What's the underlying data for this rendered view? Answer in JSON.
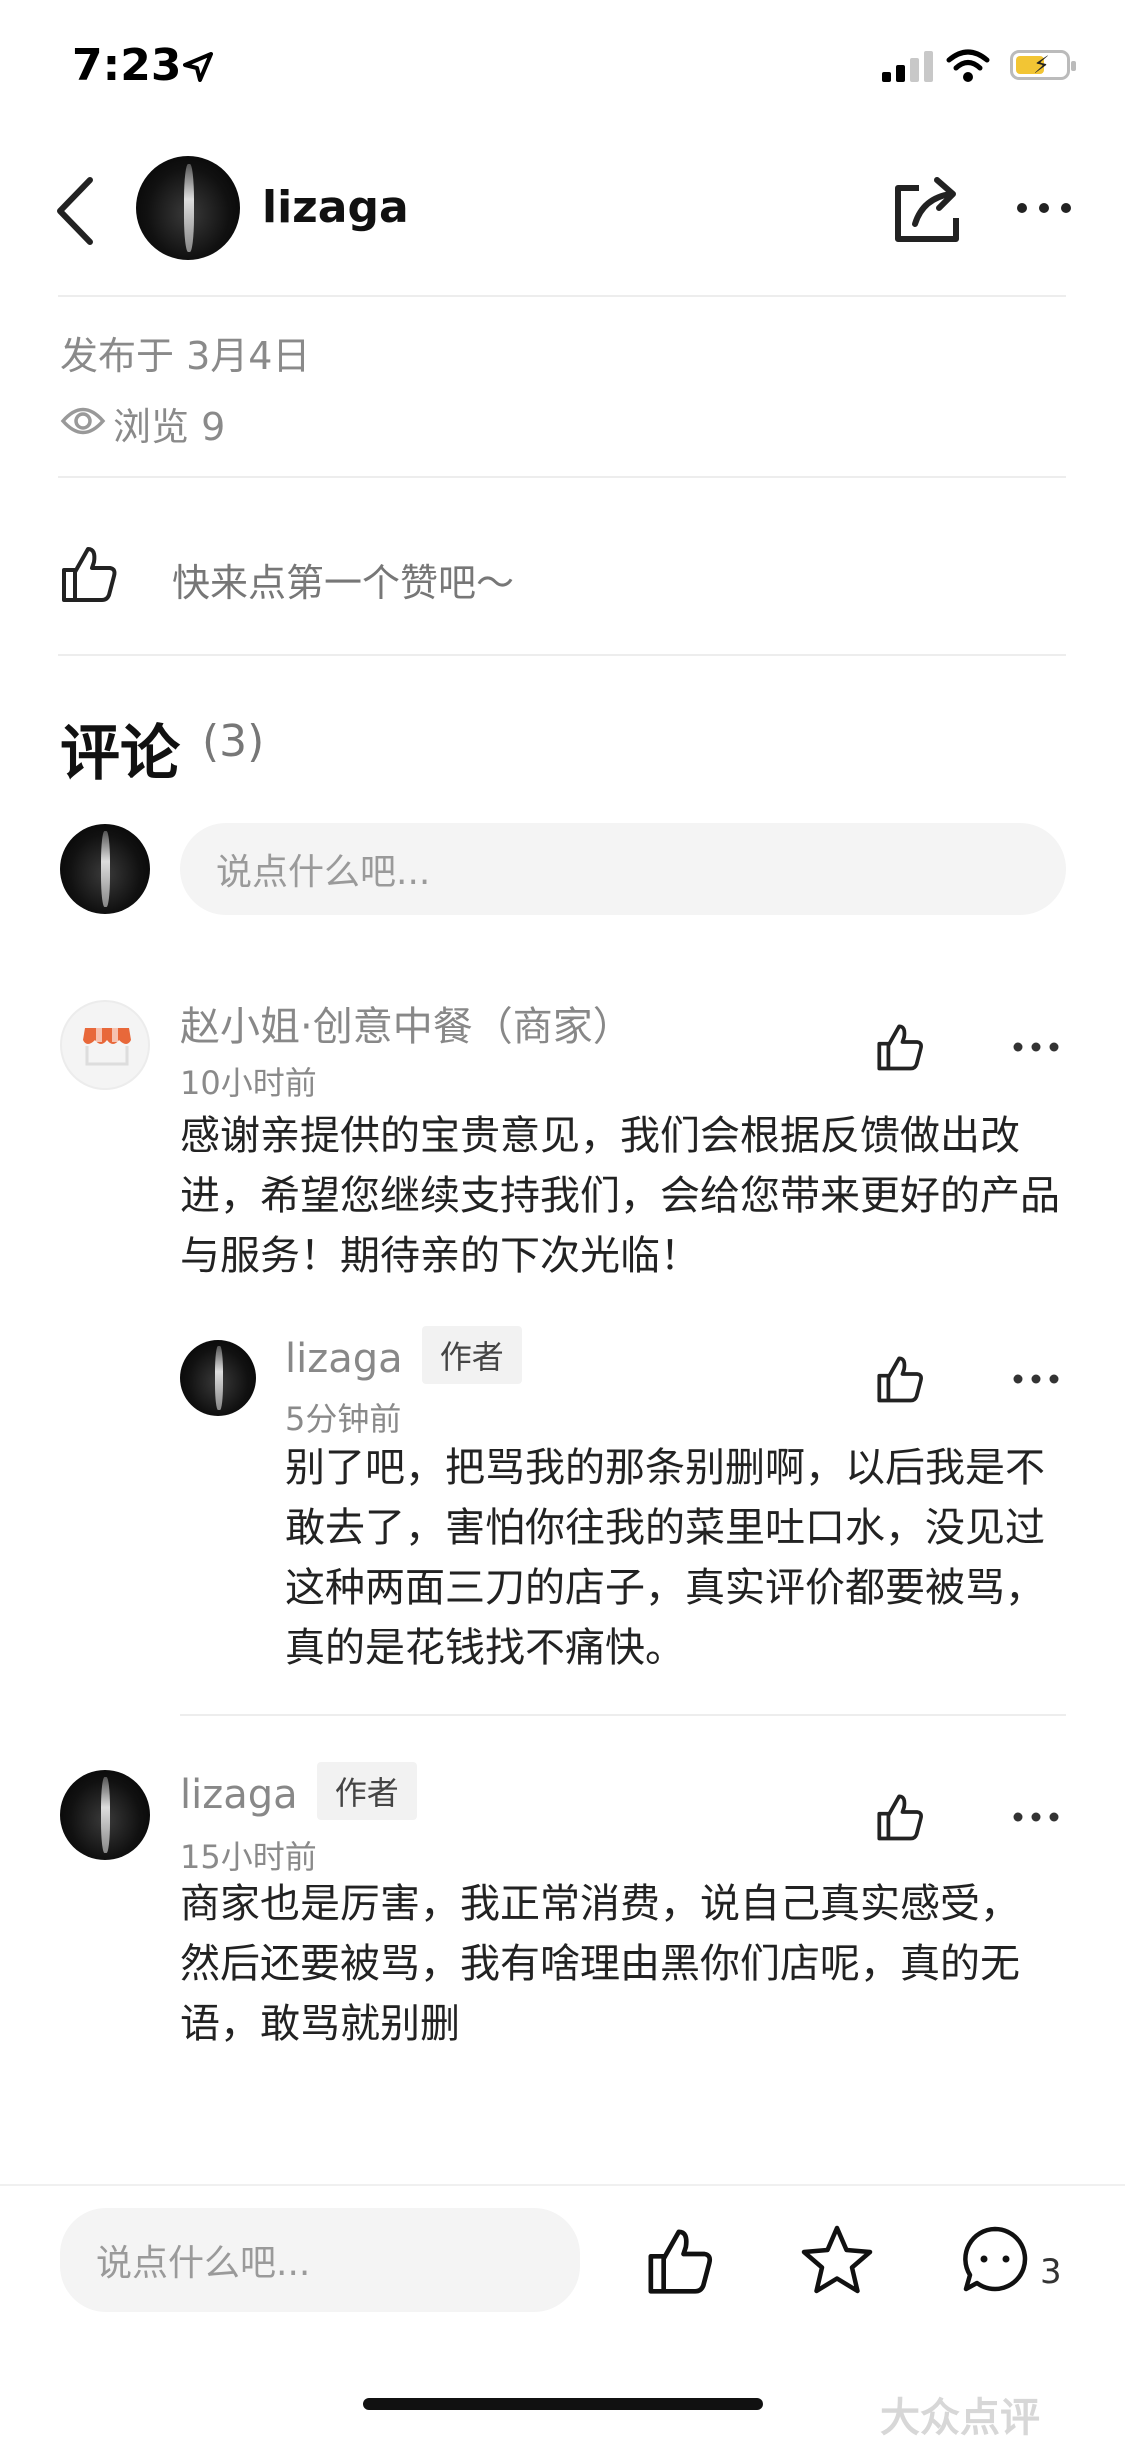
{
  "status": {
    "time": "7:23"
  },
  "header": {
    "username": "lizaga"
  },
  "post": {
    "published": "发布于 3月4日",
    "views_label": "浏览 9",
    "like_prompt": "快来点第一个赞吧～"
  },
  "comments": {
    "title": "评论",
    "count": "(3)",
    "input_placeholder": "说点什么吧...",
    "items": [
      {
        "name": "赵小姐·创意中餐（商家）",
        "time": "10小时前",
        "text": "感谢亲提供的宝贵意见，我们会根据反馈做出改进，希望您继续支持我们，会给您带来更好的产品与服务！期待亲的下次光临！",
        "reply": {
          "name": "lizaga",
          "tag": "作者",
          "time": "5分钟前",
          "text": "别了吧，把骂我的那条别删啊，以后我是不敢去了，害怕你往我的菜里吐口水，没见过这种两面三刀的店子，真实评价都要被骂，真的是花钱找不痛快。"
        }
      },
      {
        "name": "lizaga",
        "tag": "作者",
        "time": "15小时前",
        "text": "商家也是厉害，我正常消费，说自己真实感受，然后还要被骂，我有啥理由黑你们店呢，真的无语，敢骂就别删"
      }
    ]
  },
  "bottom_bar": {
    "input_placeholder": "说点什么吧...",
    "comment_count": "3"
  },
  "watermark": "大众点评",
  "colors": {
    "battery": "#f2c534",
    "merchant_awning": "#e8683a"
  }
}
